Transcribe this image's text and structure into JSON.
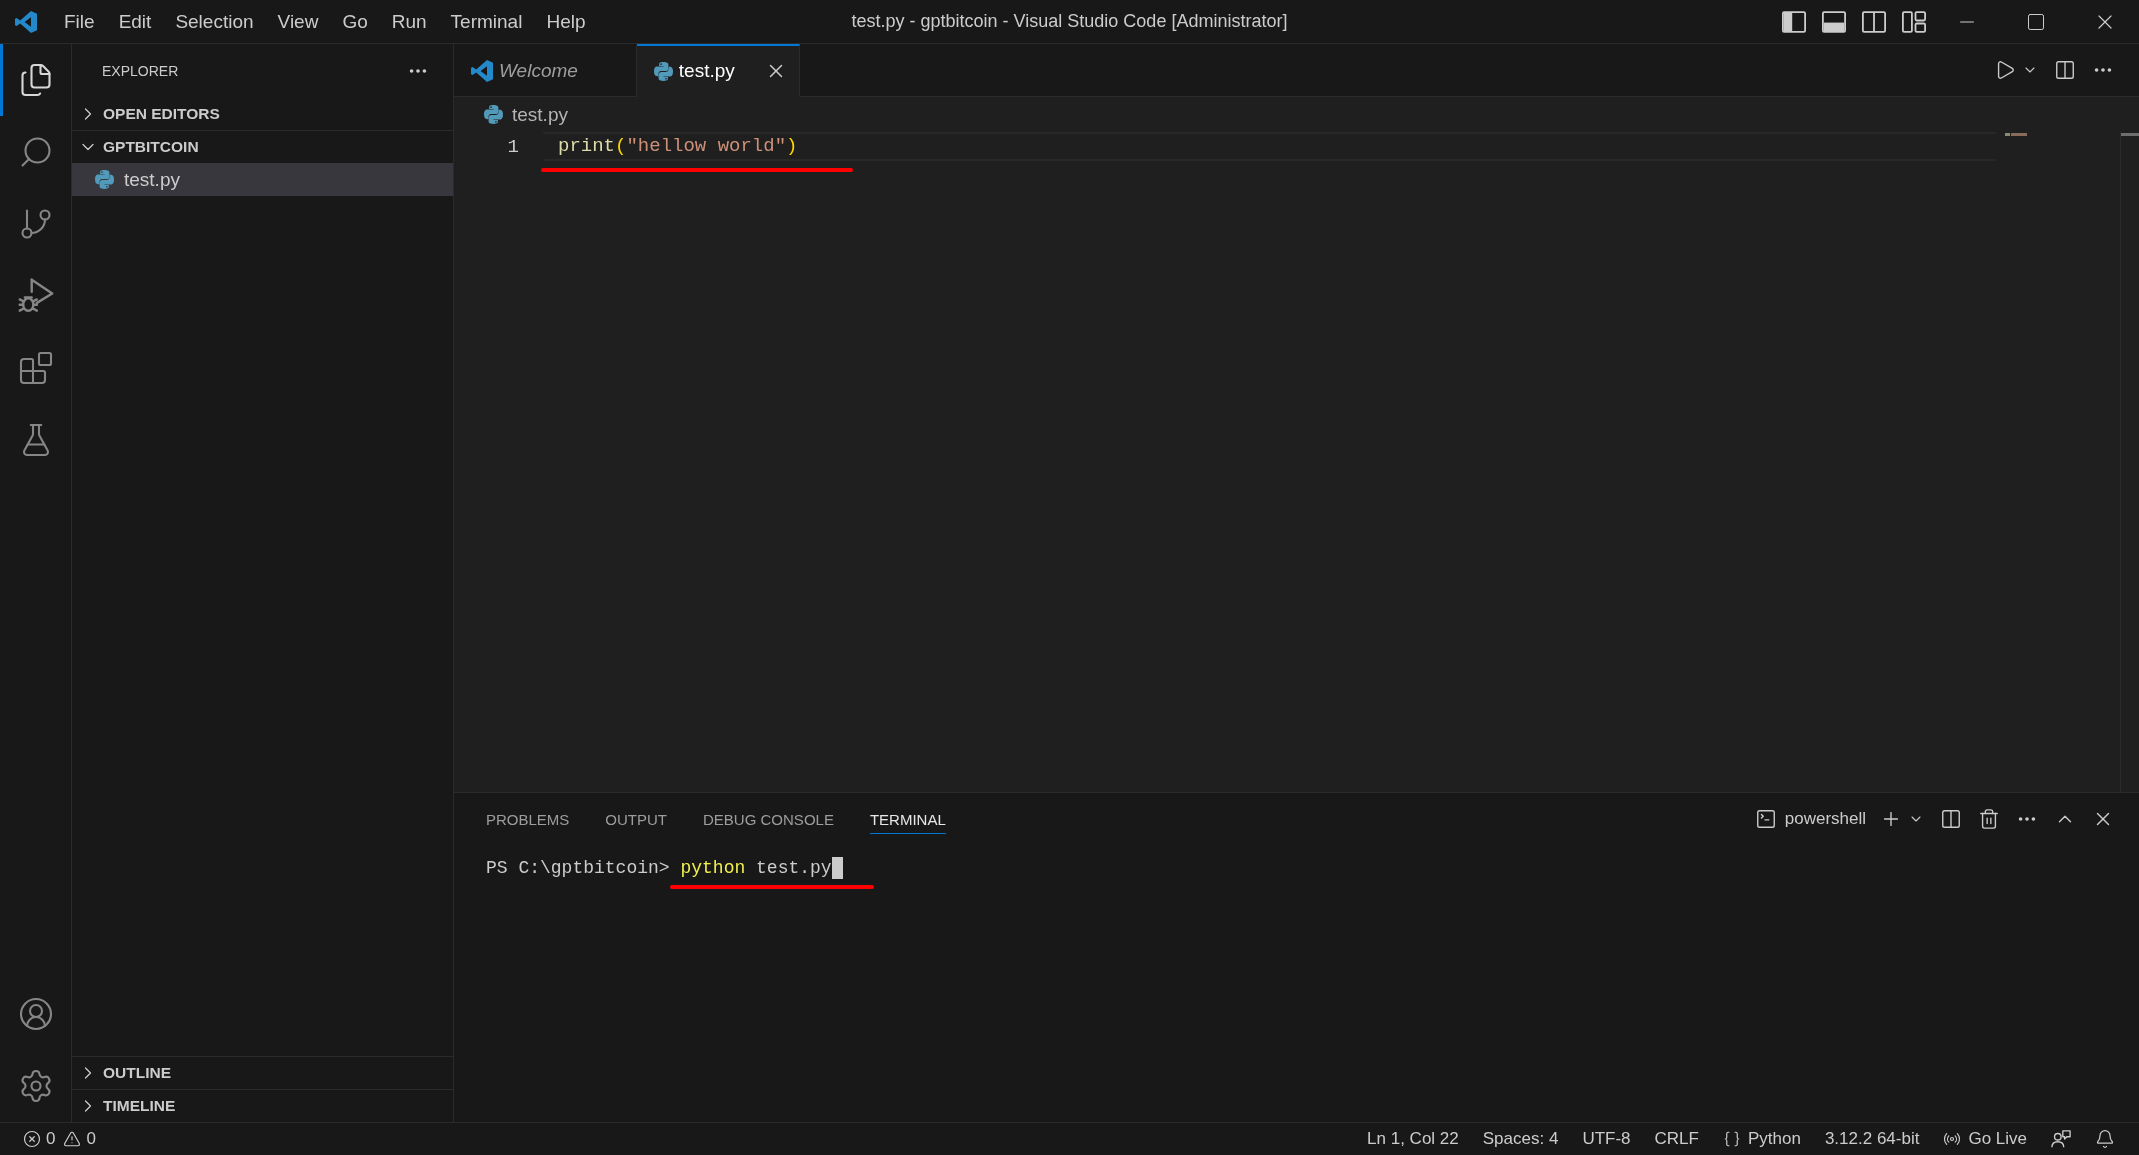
{
  "window": {
    "title": "test.py - gptbitcoin - Visual Studio Code [Administrator]"
  },
  "menu": [
    "File",
    "Edit",
    "Selection",
    "View",
    "Go",
    "Run",
    "Terminal",
    "Help"
  ],
  "activity_bar": {
    "top": [
      {
        "kind": "explorer",
        "selected": true
      },
      {
        "kind": "search",
        "selected": false
      },
      {
        "kind": "source_control",
        "selected": false
      },
      {
        "kind": "run_debug",
        "selected": false
      },
      {
        "kind": "extensions",
        "selected": false
      },
      {
        "kind": "testing",
        "selected": false
      }
    ],
    "bottom": [
      {
        "kind": "accounts"
      },
      {
        "kind": "settings"
      }
    ]
  },
  "sidebar": {
    "title": "EXPLORER",
    "sections": [
      {
        "label": "OPEN EDITORS",
        "expanded": false
      },
      {
        "label": "GPTBITCOIN",
        "expanded": true,
        "children": [
          {
            "label": "test.py",
            "kind": "python",
            "selected": true
          }
        ]
      }
    ],
    "bottom_sections": [
      {
        "label": "OUTLINE",
        "expanded": false
      },
      {
        "label": "TIMELINE",
        "expanded": false
      }
    ]
  },
  "editor": {
    "tabs": [
      {
        "label": "Welcome",
        "kind": "welcome",
        "selected": false,
        "preview": true
      },
      {
        "label": "test.py",
        "kind": "python",
        "selected": true,
        "preview": false
      }
    ],
    "breadcrumbs": [
      {
        "label": "test.py",
        "kind": "python"
      }
    ],
    "lines": [
      {
        "number": "1",
        "current": true,
        "underlined": true,
        "tokens": [
          {
            "kind": "function",
            "text": "print"
          },
          {
            "kind": "bracket",
            "text": "("
          },
          {
            "kind": "string",
            "text": "\"hellow world\""
          },
          {
            "kind": "bracket",
            "text": ")"
          }
        ]
      }
    ]
  },
  "panel": {
    "tabs": [
      {
        "label": "PROBLEMS",
        "selected": false
      },
      {
        "label": "OUTPUT",
        "selected": false
      },
      {
        "label": "DEBUG CONSOLE",
        "selected": false
      },
      {
        "label": "TERMINAL",
        "selected": true
      }
    ],
    "terminal_name": "powershell",
    "terminal_lines": [
      {
        "prompt": "PS C:\\gptbitcoin>",
        "tokens": [
          {
            "kind": "command",
            "text": "python"
          },
          {
            "kind": "argument",
            "text": "test.py"
          }
        ],
        "cursor": true,
        "underlined": true
      }
    ]
  },
  "status_bar": {
    "problems": [
      {
        "kind": "error",
        "count": "0"
      },
      {
        "kind": "warning",
        "count": "0"
      }
    ],
    "items": [
      {
        "kind": "text",
        "text": "Ln 1, Col 22"
      },
      {
        "kind": "text",
        "text": "Spaces: 4"
      },
      {
        "kind": "text",
        "text": "UTF-8"
      },
      {
        "kind": "text",
        "text": "CRLF"
      },
      {
        "kind": "language",
        "text": "Python"
      },
      {
        "kind": "text",
        "text": "3.12.2 64-bit"
      },
      {
        "kind": "live",
        "text": "Go Live"
      },
      {
        "kind": "feedback"
      },
      {
        "kind": "notifications"
      }
    ]
  }
}
